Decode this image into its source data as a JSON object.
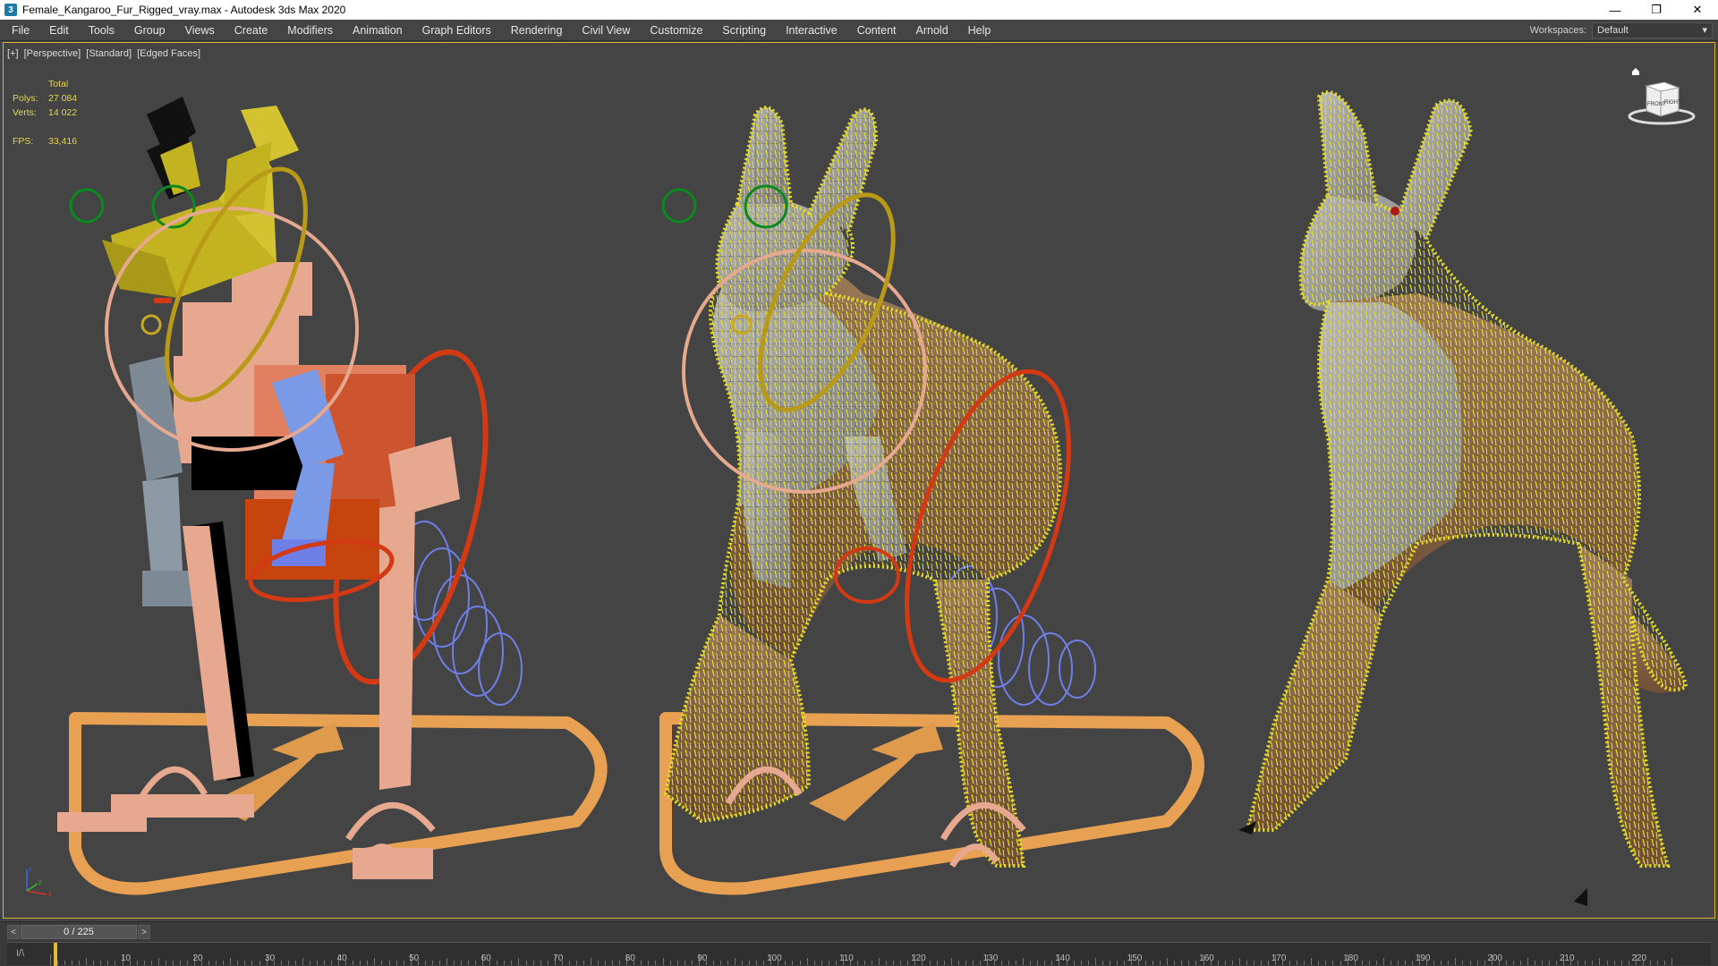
{
  "window": {
    "title": "Female_Kangaroo_Fur_Rigged_vray.max - Autodesk 3ds Max 2020",
    "app_icon": "3",
    "controls": {
      "minimize": "—",
      "restore": "❐",
      "close": "✕"
    }
  },
  "menu": {
    "items": [
      "File",
      "Edit",
      "Tools",
      "Group",
      "Views",
      "Create",
      "Modifiers",
      "Animation",
      "Graph Editors",
      "Rendering",
      "Civil View",
      "Customize",
      "Scripting",
      "Interactive",
      "Content",
      "Arnold",
      "Help"
    ],
    "workspaces_label": "Workspaces:",
    "workspace_value": "Default"
  },
  "viewport": {
    "labels": [
      "[+]",
      "[Perspective]",
      "[Standard]",
      "[Edged Faces]"
    ],
    "stats": {
      "total_label": "Total",
      "polys_label": "Polys:",
      "polys": "27 084",
      "verts_label": "Verts:",
      "verts": "14 022",
      "fps_label": "FPS:",
      "fps": "33,416"
    },
    "viewcube": {
      "front": "FRONT",
      "right": "RIGHT"
    },
    "axis": {
      "x": "x",
      "y": "y",
      "z": "z"
    }
  },
  "timeline": {
    "frame_display": "0 / 225",
    "prev": "<",
    "next": ">",
    "mode_icon": "I/\\",
    "ticks": [
      10,
      20,
      30,
      40,
      50,
      60,
      70,
      80,
      90,
      100,
      110,
      120,
      130,
      140,
      150,
      160,
      170,
      180,
      190,
      200,
      210,
      220
    ],
    "max_frame": 225
  },
  "colors": {
    "accent": "#d8b33c",
    "viewport_bg": "#444444",
    "fur_yellow": "#e8e020",
    "control_peach": "#e0a890",
    "control_red": "#d33a14",
    "control_blue": "#6f7fe8",
    "control_orange": "#e8a052",
    "control_green": "#0a8a1e"
  }
}
